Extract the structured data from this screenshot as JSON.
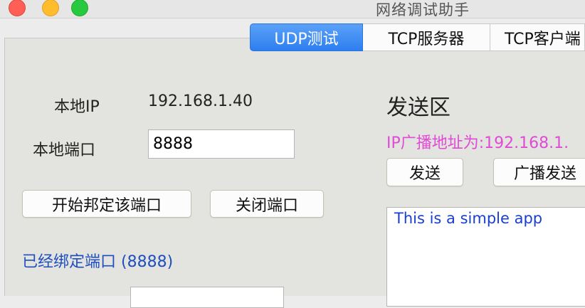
{
  "window": {
    "title": "网络调试助手"
  },
  "tabs": [
    {
      "label": "UDP测试",
      "active": true
    },
    {
      "label": "TCP服务器",
      "active": false
    },
    {
      "label": "TCP客户端",
      "active": false
    }
  ],
  "left": {
    "local_ip_label": "本地IP",
    "local_ip_value": "192.168.1.40",
    "local_port_label": "本地端口",
    "local_port_value": "8888",
    "bind_button": "开始邦定该端口",
    "close_button": "关闭端口",
    "status_text": "已经绑定端口 (8888)"
  },
  "right": {
    "send_area_title": "发送区",
    "broadcast_text": "IP广播地址为:192.168.1.",
    "send_button": "发送",
    "broadcast_button": "广播发送",
    "message_text": "This is a simple app"
  },
  "colors": {
    "accent": "#2e7ef0",
    "broadcast": "#e04bd6",
    "status": "#1f4fbf",
    "message": "#1a3fd0"
  }
}
